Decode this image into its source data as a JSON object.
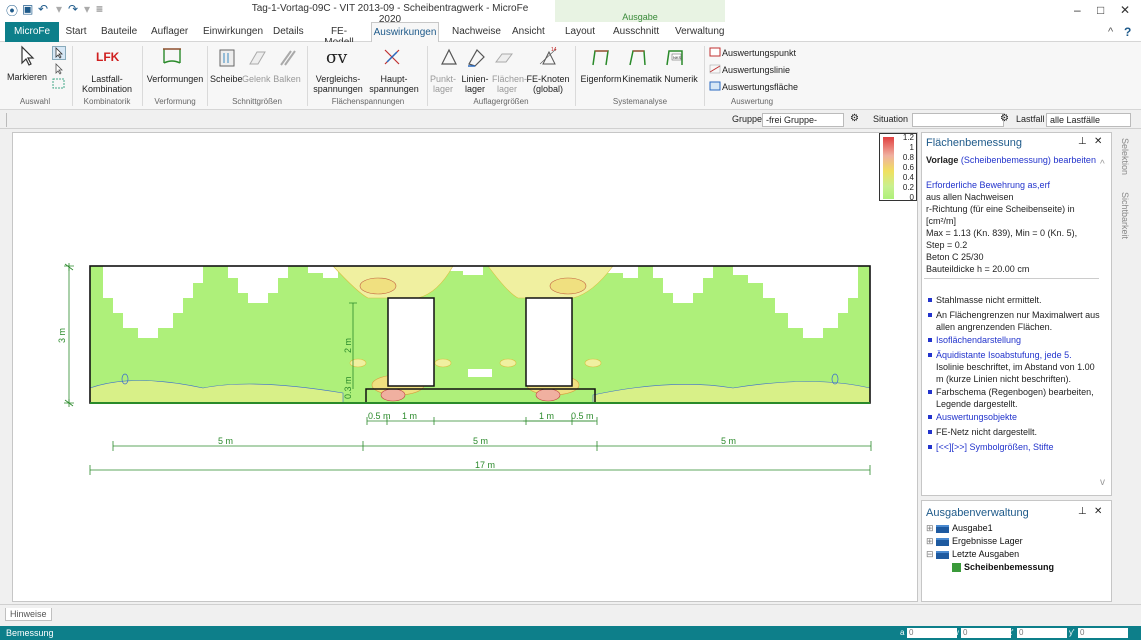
{
  "window": {
    "title": "Tag-1-Vortag-09C - VIT 2013-09 - Scheibentragwerk - MicroFe 2020",
    "context_tab_group": "Ausgabe"
  },
  "tabs": [
    "MicroFe",
    "Start",
    "Bauteile",
    "Auflager",
    "Einwirkungen",
    "Details",
    "FE-Modell",
    "Auswirkungen",
    "Nachweise",
    "Ansicht",
    "Layout",
    "Ausschnitt",
    "Verwaltung"
  ],
  "ribbon": {
    "markieren": "Markieren",
    "lastfall": "Lastfall-\nKombination",
    "lfk_icon": "LFK",
    "verformungen": "Verformungen",
    "scheibe": "Scheibe",
    "gelenk": "Gelenk",
    "balken": "Balken",
    "vergleich": "Vergleichs-\nspannungen",
    "haupt": "Haupt-\nspannungen",
    "sigma": "σv",
    "punkt": "Punkt-\nlager",
    "linien": "Linien-\nlager",
    "flaechen": "Flächen-\nlager",
    "feknoten": "FE-Knoten\n(global)",
    "eigenform": "Eigenform",
    "kinematik": "Kinematik",
    "numerik": "Numerik",
    "ausw_punkt": "Auswertungspunkt",
    "ausw_linie": "Auswertungslinie",
    "ausw_flaeche": "Auswertungsfläche",
    "groups": [
      "Auswahl",
      "Kombinatorik",
      "Verformung",
      "Schnittgrößen",
      "Flächenspannungen",
      "Auflagergrößen",
      "Systemanalyse",
      "Auswertung"
    ]
  },
  "filter": {
    "gruppe_label": "Gruppe",
    "gruppe_value": "-frei Gruppe-",
    "situation_label": "Situation",
    "lastfall_label": "Lastfall",
    "lastfall_value": "alle Lastfälle"
  },
  "legend": {
    "values": [
      "1.2",
      "1",
      "0.8",
      "0.6",
      "0.4",
      "0.2",
      "0"
    ],
    "colors": [
      "#e04040",
      "#f07070",
      "#f0b0a0",
      "#f0e060",
      "#e8f080",
      "#c8f090",
      "#aef07a"
    ]
  },
  "dimensions": {
    "height": "3 m",
    "inner_height_a": "2 m",
    "inner_height_b": "0.3 m",
    "d1": "0.5 m",
    "d2": "1 m",
    "d3": "1 m",
    "d4": "0.5 m",
    "span1": "5 m",
    "span2": "5 m",
    "span3": "5 m",
    "total": "17 m"
  },
  "panel": {
    "title": "Flächenbemessung",
    "vorlage": "Vorlage",
    "vorlage_link": "(Scheibenbemessung) bearbeiten",
    "lines": [
      "Erforderliche Bewehrung as,erf",
      "aus allen Nachweisen",
      "r-Richtung (für eine Scheibenseite) in",
      "[cm²/m]",
      "Max = 1.13 (Kn. 839), Min = 0 (Kn. 5),",
      "Step = 0.2",
      "Beton C 25/30",
      "Bauteildicke h = 20.00 cm"
    ],
    "bullets": [
      "Stahlmasse nicht ermittelt.",
      "An Flächengrenzen nur Maximalwert aus",
      "allen angrenzenden Flächen.",
      "Isoflächendarstellung",
      "Äquidistante Isoabstufung, jede 5.",
      "Isolinie beschriftet, im Abstand von 1.00",
      "m (kurze Linien nicht beschriften).",
      "Farbschema (Regenbogen) bearbeiten,",
      "Legende dargestellt.",
      "Auswertungsobjekte",
      "FE-Netz nicht dargestellt.",
      "[<<][>>] Symbolgrößen, Stifte"
    ]
  },
  "output": {
    "title": "Ausgabenverwaltung",
    "items": [
      "Ausgabe1",
      "Ergebnisse Lager",
      "Letzte Ausgaben",
      "Scheibenbemessung"
    ]
  },
  "vtabs": [
    "Selektion",
    "Sichtbarkeit"
  ],
  "bottom": {
    "hinweise": "Hinweise",
    "status": "Bemessung",
    "a_label": "a",
    "a": "0",
    "w_label": "w",
    "w": "0",
    "x_label": "x'",
    "x": "0",
    "y_label": "y'",
    "y": "0"
  },
  "colors": {
    "accent": "#0d7f8a",
    "tab_blue": "#1e5a8a",
    "fill": "#aef07a"
  }
}
